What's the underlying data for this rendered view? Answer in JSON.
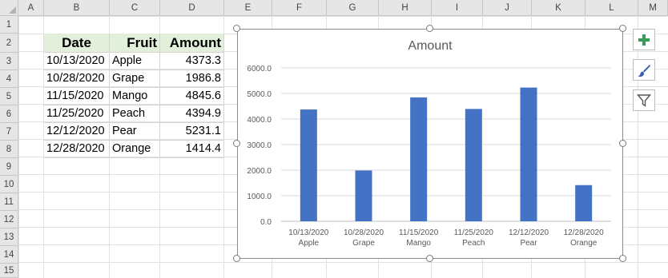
{
  "columns": [
    "A",
    "B",
    "C",
    "D",
    "E",
    "F",
    "G",
    "H",
    "I",
    "J",
    "K",
    "L",
    "M"
  ],
  "rows": [
    "1",
    "2",
    "3",
    "4",
    "5",
    "6",
    "7",
    "8",
    "9",
    "10",
    "11",
    "12",
    "13",
    "14",
    "15"
  ],
  "table": {
    "headers": [
      "Date",
      "Fruit",
      "Amount"
    ],
    "rows": [
      [
        "10/13/2020",
        "Apple",
        "4373.3"
      ],
      [
        "10/28/2020",
        "Grape",
        "1986.8"
      ],
      [
        "11/15/2020",
        "Mango",
        "4845.6"
      ],
      [
        "11/25/2020",
        "Peach",
        "4394.9"
      ],
      [
        "12/12/2020",
        "Pear",
        "5231.1"
      ],
      [
        "12/28/2020",
        "Orange",
        "1414.4"
      ]
    ]
  },
  "chart_data": {
    "type": "bar",
    "title": "Amount",
    "categories": [
      [
        "10/13/2020",
        "Apple"
      ],
      [
        "10/28/2020",
        "Grape"
      ],
      [
        "11/15/2020",
        "Mango"
      ],
      [
        "11/25/2020",
        "Peach"
      ],
      [
        "12/12/2020",
        "Pear"
      ],
      [
        "12/28/2020",
        "Orange"
      ]
    ],
    "values": [
      4373.3,
      1986.8,
      4845.6,
      4394.9,
      5231.1,
      1414.4
    ],
    "ylim": [
      0,
      6000
    ],
    "yticks": [
      "0.0",
      "1000.0",
      "2000.0",
      "3000.0",
      "4000.0",
      "5000.0",
      "6000.0"
    ],
    "grid": true,
    "bar_color": "#4472c4"
  },
  "side_buttons": [
    {
      "name": "chart-elements-plus-icon"
    },
    {
      "name": "chart-styles-brush-icon"
    },
    {
      "name": "chart-filters-funnel-icon"
    }
  ]
}
